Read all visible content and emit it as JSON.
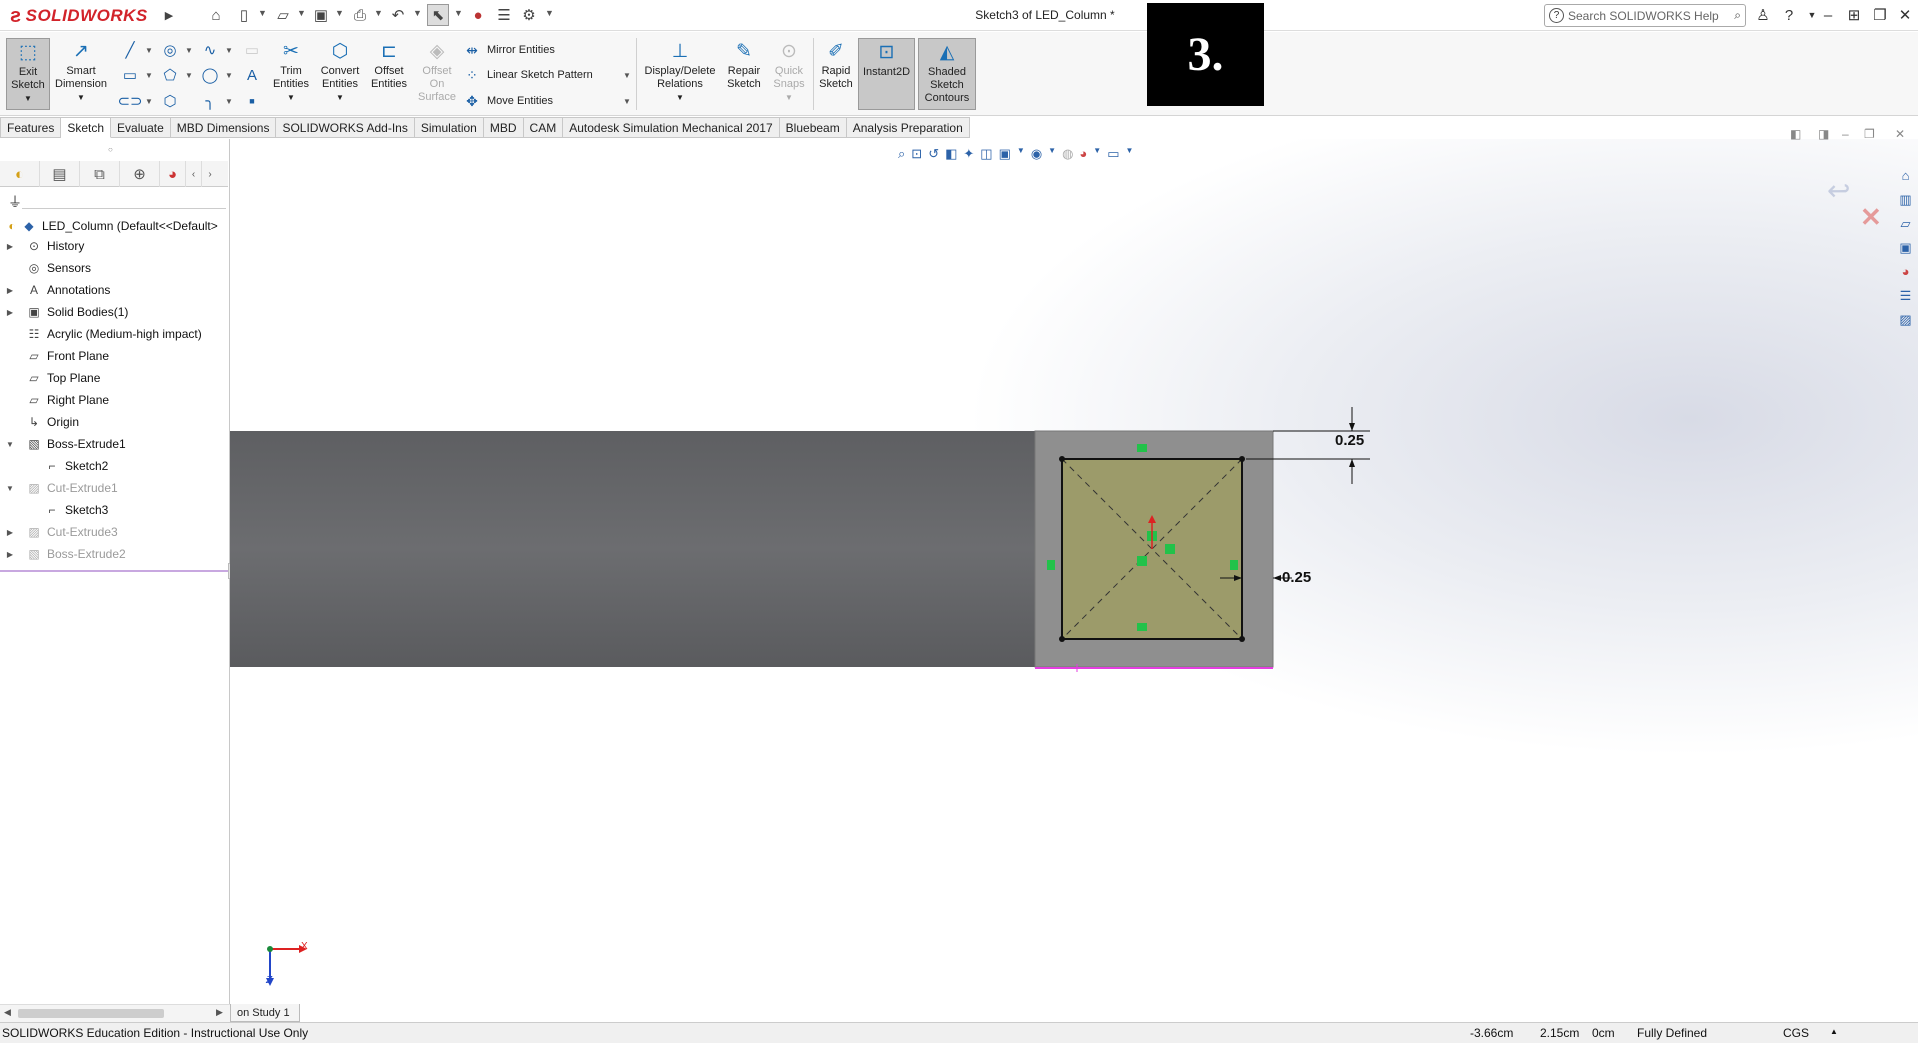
{
  "app": {
    "brand": "SOLIDWORKS",
    "document_title": "Sketch3 of LED_Column *",
    "search_placeholder": "Search SOLIDWORKS Help",
    "step_label": "3."
  },
  "toolbar_quick": {
    "icons": [
      "home-icon",
      "new-document-icon",
      "open-icon",
      "save-icon",
      "print-icon",
      "undo-icon",
      "select-icon",
      "rebuild-icon",
      "file-properties-icon",
      "options-icon"
    ]
  },
  "command_manager": {
    "exit_sketch": "Exit\nSketch",
    "smart_dimension": "Smart\nDimension",
    "trim_entities": "Trim\nEntities",
    "convert_entities": "Convert\nEntities",
    "offset_entities": "Offset\nEntities",
    "offset_on_surface": "Offset\nOn\nSurface",
    "mirror_entities": "Mirror Entities",
    "linear_sketch_pattern": "Linear Sketch Pattern",
    "move_entities": "Move Entities",
    "display_delete_relations": "Display/Delete\nRelations",
    "repair_sketch": "Repair\nSketch",
    "quick_snaps": "Quick\nSnaps",
    "rapid_sketch": "Rapid\nSketch",
    "instant2d": "Instant2D",
    "shaded_sketch_contours": "Shaded\nSketch\nContours"
  },
  "tabs": [
    {
      "label": "Features",
      "active": false
    },
    {
      "label": "Sketch",
      "active": true
    },
    {
      "label": "Evaluate",
      "active": false
    },
    {
      "label": "MBD Dimensions",
      "active": false
    },
    {
      "label": "SOLIDWORKS Add-Ins",
      "active": false
    },
    {
      "label": "Simulation",
      "active": false
    },
    {
      "label": "MBD",
      "active": false
    },
    {
      "label": "CAM",
      "active": false
    },
    {
      "label": "Autodesk Simulation Mechanical 2017",
      "active": false
    },
    {
      "label": "Bluebeam",
      "active": false
    },
    {
      "label": "Analysis Preparation",
      "active": false
    }
  ],
  "feature_tree": {
    "root": "LED_Column  (Default<<Default>",
    "items": [
      {
        "label": "History",
        "icon": "history-icon",
        "expander": "collapsed",
        "dim": false
      },
      {
        "label": "Sensors",
        "icon": "sensors-icon",
        "expander": "none",
        "dim": false
      },
      {
        "label": "Annotations",
        "icon": "annotations-icon",
        "expander": "collapsed",
        "dim": false
      },
      {
        "label": "Solid Bodies(1)",
        "icon": "solid-bodies-icon",
        "expander": "collapsed",
        "dim": false
      },
      {
        "label": "Acrylic (Medium-high impact)",
        "icon": "material-icon",
        "expander": "none",
        "dim": false
      },
      {
        "label": "Front Plane",
        "icon": "plane-icon",
        "expander": "none",
        "dim": false
      },
      {
        "label": "Top Plane",
        "icon": "plane-icon",
        "expander": "none",
        "dim": false
      },
      {
        "label": "Right Plane",
        "icon": "plane-icon",
        "expander": "none",
        "dim": false
      },
      {
        "label": "Origin",
        "icon": "origin-icon",
        "expander": "none",
        "dim": false
      },
      {
        "label": "Boss-Extrude1",
        "icon": "extrude-icon",
        "expander": "expanded",
        "dim": false
      },
      {
        "label": "Sketch2",
        "icon": "sketch-icon",
        "expander": "child",
        "dim": false
      },
      {
        "label": "Cut-Extrude1",
        "icon": "cut-extrude-icon",
        "expander": "expanded",
        "dim": true
      },
      {
        "label": "Sketch3",
        "icon": "sketch-icon",
        "expander": "child",
        "dim": false
      },
      {
        "label": "Cut-Extrude3",
        "icon": "cut-extrude-icon",
        "expander": "collapsed",
        "dim": true
      },
      {
        "label": "Boss-Extrude2",
        "icon": "extrude-icon",
        "expander": "collapsed",
        "dim": true
      }
    ]
  },
  "sketch": {
    "dimension_top": "0.25",
    "dimension_right": "0.25"
  },
  "triad": {
    "x_label": "X",
    "z_label": "Z"
  },
  "bottom": {
    "study_tab": "on Study 1"
  },
  "status_bar": {
    "edition": "SOLIDWORKS Education Edition - Instructional Use Only",
    "x": "-3.66cm",
    "y": "2.15cm",
    "z": "0cm",
    "state": "Fully Defined",
    "units": "CGS"
  }
}
